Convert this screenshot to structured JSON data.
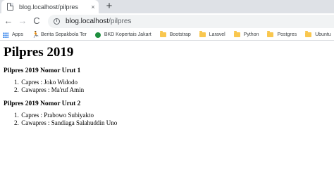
{
  "tab": {
    "title": "blog.localhost/pilpres",
    "close": "×"
  },
  "newtab": "+",
  "toolbar": {
    "back": "←",
    "forward": "→",
    "reload": "C",
    "url_host": "blog.localhost",
    "url_path": "/pilpres"
  },
  "bookmarks": [
    {
      "label": "Apps",
      "icon": "apps-grid-icon"
    },
    {
      "label": "Berita Sepakbola Ter",
      "icon": "runner-icon"
    },
    {
      "label": "BKD Kopertais Jakart",
      "icon": "seal-icon"
    },
    {
      "label": "Bootstrap",
      "icon": "folder-icon"
    },
    {
      "label": "Laravel",
      "icon": "folder-icon"
    },
    {
      "label": "Python",
      "icon": "folder-icon"
    },
    {
      "label": "Postgres",
      "icon": "folder-icon"
    },
    {
      "label": "Ubuntu",
      "icon": "folder-icon"
    }
  ],
  "page": {
    "title": "Pilpres 2019",
    "sections": [
      {
        "heading": "Pilpres 2019 Nomor Urut 1",
        "items": [
          {
            "num": "1.",
            "text": "Capres : Joko Widodo"
          },
          {
            "num": "2.",
            "text": "Cawapres : Ma'ruf Amin"
          }
        ]
      },
      {
        "heading": "Pilpres 2019 Nomor Urut 2",
        "items": [
          {
            "num": "1.",
            "text": "Capres : Prabowo Subiyakto"
          },
          {
            "num": "2.",
            "text": "Cawapres : Sandiaga Salahuddin Uno"
          }
        ]
      }
    ]
  }
}
